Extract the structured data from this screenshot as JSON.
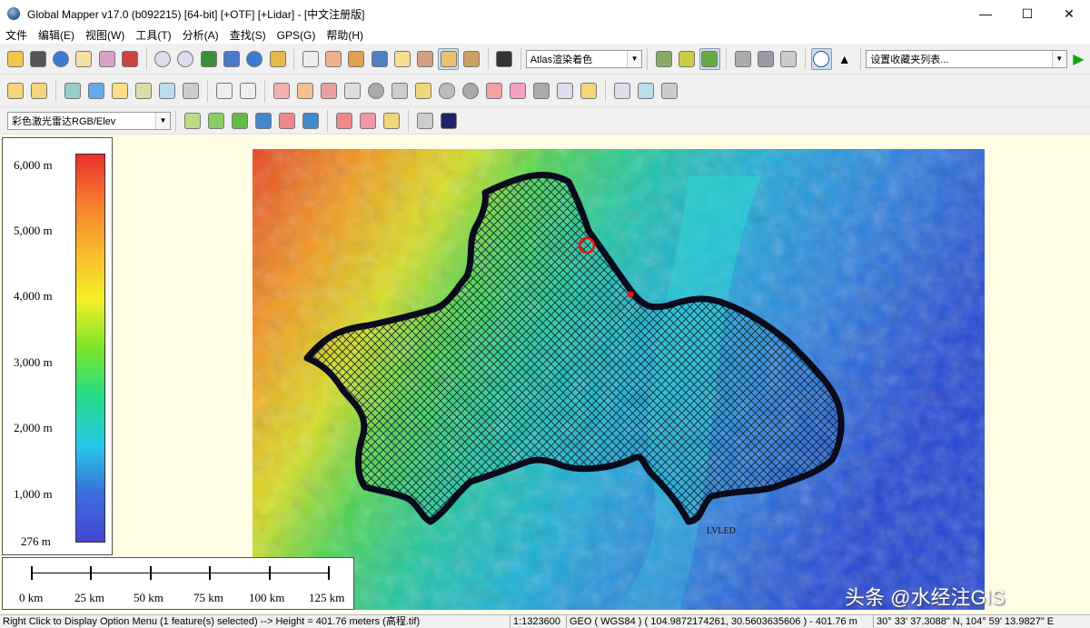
{
  "window": {
    "title": "Global Mapper v17.0 (b092215) [64-bit] [+OTF] [+Lidar] - [中文注册版]",
    "minimize": "—",
    "maximize": "☐",
    "close": "✕"
  },
  "menu": [
    "文件",
    "编辑(E)",
    "视图(W)",
    "工具(T)",
    "分析(A)",
    "查找(S)",
    "GPS(G)",
    "帮助(H)"
  ],
  "toolbar": {
    "shader_select": "Atlas渲染着色",
    "bookmark_select": "设置收藏夹列表...",
    "layer_select": "彩色激光雷达RGB/Elev"
  },
  "legend": {
    "labels": [
      "6,000 m",
      "5,000 m",
      "4,000 m",
      "3,000 m",
      "2,000 m",
      "1,000 m",
      "276 m"
    ],
    "colors": [
      "#e8302c",
      "#f77d2e",
      "#f8ba2c",
      "#f5f027",
      "#7be52a",
      "#24dc8a",
      "#27c9e6",
      "#3a6fdb",
      "#4646d2"
    ]
  },
  "scale": {
    "labels": [
      "0 km",
      "25 km",
      "50 km",
      "75 km",
      "100 km",
      "125 km"
    ]
  },
  "status": {
    "message": "Right Click to Display Option Menu (1 feature(s) selected) --> Height = 401.76 meters (高程.tif)",
    "scale": "1:1323600",
    "coords": "GEO ( WGS84 ) ( 104.9872174261, 30.5603635606 ) - 401.76 m",
    "dms": "30° 33' 37.3088\" N, 104° 59' 13.9827\" E"
  },
  "map": {
    "feature_label": "LVLED"
  },
  "watermark": "头条 @水经注GIS"
}
